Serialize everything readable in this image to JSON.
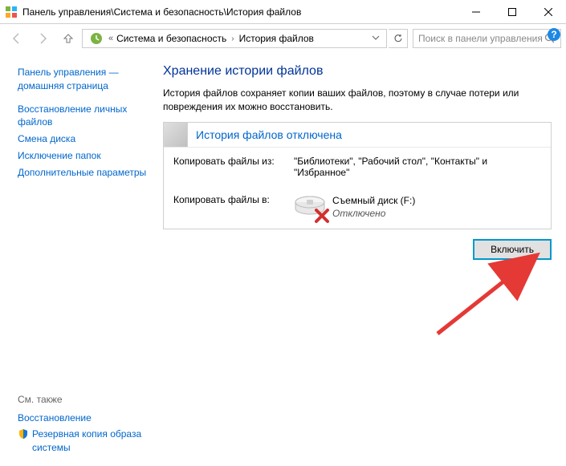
{
  "titlebar": {
    "text": "Панель управления\\Система и безопасность\\История файлов"
  },
  "breadcrumb": {
    "seg1": "Система и безопасность",
    "seg2": "История файлов"
  },
  "search": {
    "placeholder": "Поиск в панели управления"
  },
  "sidebar": {
    "home1": "Панель управления —",
    "home2": "домашняя страница",
    "links": {
      "restore1": "Восстановление личных",
      "restore2": "файлов",
      "drive": "Смена диска",
      "exclude": "Исключение папок",
      "advanced": "Дополнительные параметры"
    },
    "see_also": "См. также",
    "bottom": {
      "recovery": "Восстановление",
      "backup1": "Резервная копия образа",
      "backup2": "системы"
    }
  },
  "content": {
    "title": "Хранение истории файлов",
    "desc": "История файлов сохраняет копии ваших файлов, поэтому в случае потери или повреждения их можно восстановить.",
    "status_title": "История файлов отключена",
    "copy_from_label": "Копировать файлы из:",
    "copy_from_value": "\"Библиотеки\", \"Рабочий стол\", \"Контакты\" и \"Избранное\"",
    "copy_to_label": "Копировать файлы в:",
    "drive_name": "Съемный диск (F:)",
    "drive_status": "Отключено",
    "enable_btn": "Включить"
  }
}
